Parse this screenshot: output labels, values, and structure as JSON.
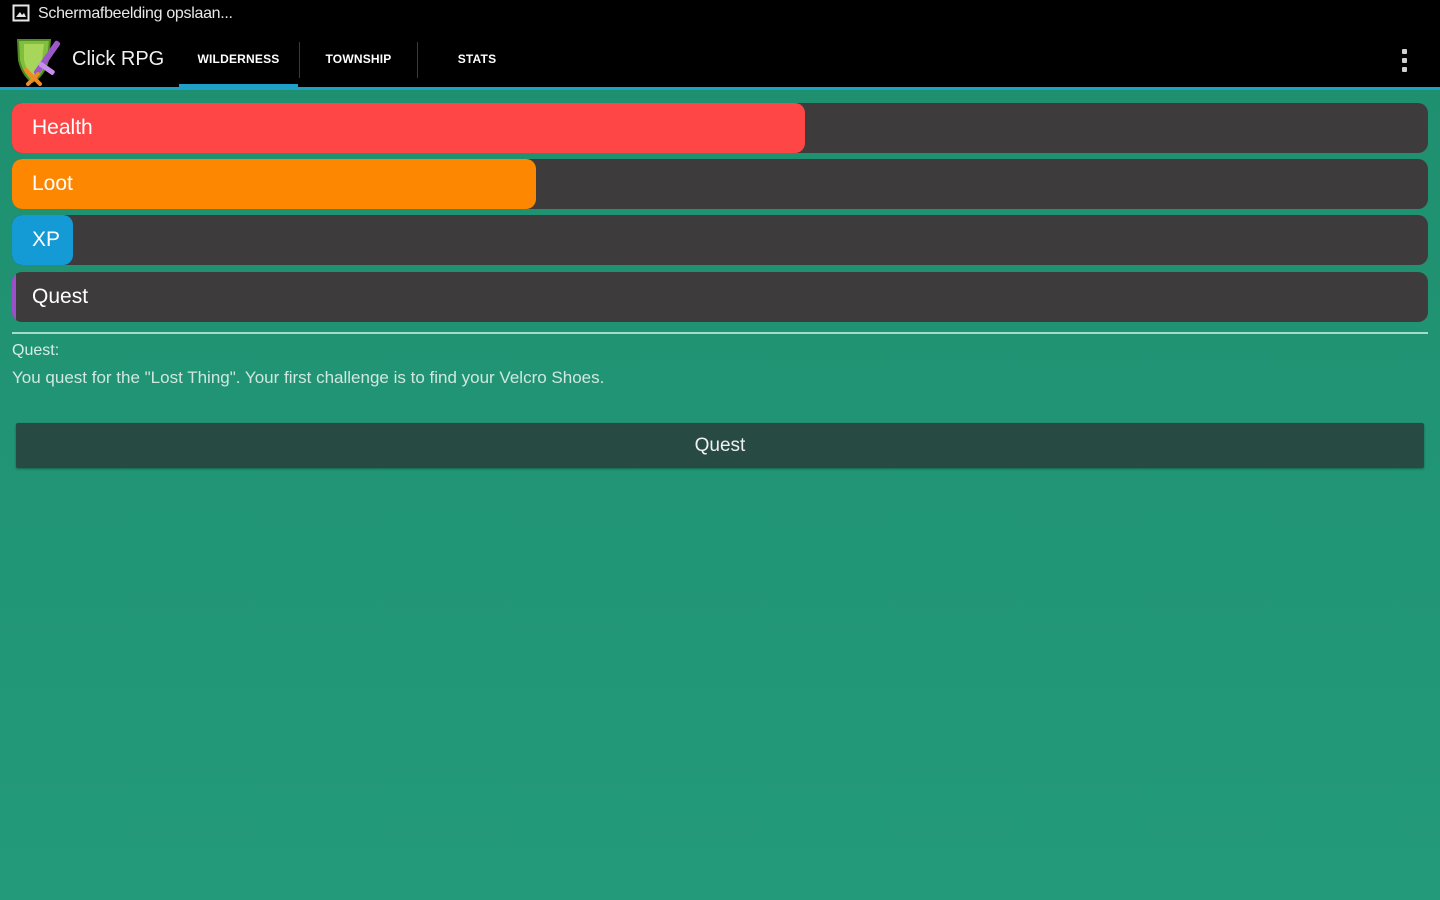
{
  "status_bar": {
    "notification_text": "Schermafbeelding opslaan...",
    "icon": "screenshot-icon"
  },
  "action_bar": {
    "app_title": "Click RPG",
    "logo_icon": "shield-swords-icon",
    "tabs": [
      {
        "label": "WILDERNESS",
        "selected": true
      },
      {
        "label": "TOWNSHIP",
        "selected": false
      },
      {
        "label": "STATS",
        "selected": false
      }
    ],
    "overflow_icon": "more-vertical-icon",
    "accent_color": "#1fa0c8"
  },
  "bars": {
    "health": {
      "label": "Health",
      "fill_fraction": 0.56,
      "color": "#fd4645"
    },
    "loot": {
      "label": "Loot",
      "fill_fraction": 0.37,
      "color": "#fe8701"
    },
    "xp": {
      "label": "XP",
      "fill_fraction": 0.043,
      "color": "#149ad4"
    },
    "quest": {
      "label": "Quest",
      "fill_fraction": 0.0,
      "color": "#9b4fc9"
    }
  },
  "quest_info": {
    "heading": "Quest:",
    "description": "You quest for the \"Lost Thing\". Your first challenge is to find your Velcro Shoes."
  },
  "quest_button": {
    "label": "Quest"
  },
  "colors": {
    "background": "#1e8f6f",
    "bar_track": "#3d3b3c",
    "button": "#274a43"
  }
}
